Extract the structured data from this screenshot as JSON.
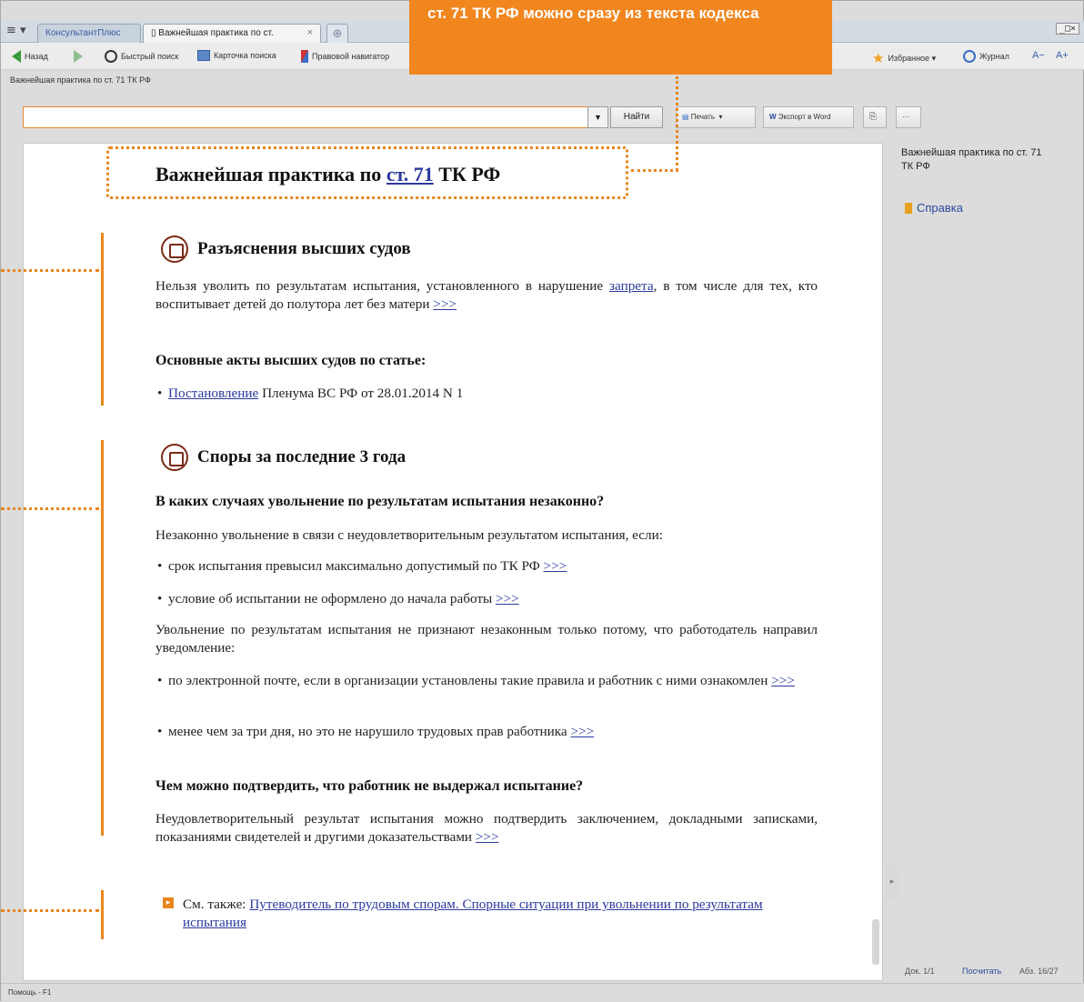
{
  "callout": {
    "text": "ст. 71 ТК РФ можно сразу из текста кодекса"
  },
  "window": {
    "controls": "_□×"
  },
  "tabs": [
    {
      "label": "КонсультантПлюс"
    },
    {
      "label": "Важнейшая практика по ст."
    }
  ],
  "toolbar": {
    "back": "Назад",
    "quick_search": "Быстрый поиск",
    "search_card": "Карточка поиска",
    "legal_navigator": "Правовой навигатор",
    "favorites": "Избранное ▾",
    "journal": "Журнал",
    "font_small": "A−",
    "font_large": "A+"
  },
  "breadcrumb": "Важнейшая практика по ст. 71 ТК РФ",
  "search": {
    "value": "",
    "find_label": "Найти",
    "dropdown": "▼"
  },
  "actions": {
    "print": "Печать",
    "print_arrow": "▾",
    "export_word": "Экспорт в Word",
    "more": "···"
  },
  "document": {
    "title_prefix": "Важнейшая практика по ",
    "title_link": "ст. 71",
    "title_suffix": " ТК РФ",
    "sec1": {
      "heading": "Разъяснения высших судов",
      "p1_a": "Нельзя уволить по результатам испытания, установленного в нарушение ",
      "p1_link": "запрета",
      "p1_b": ", в том числе для тех, кто воспитывает детей до полутора лет без матери ",
      "more": ">>>",
      "acts_heading": "Основные акты высших судов по статье:",
      "act_link": "Постановление",
      "act_rest": " Пленума ВС РФ от 28.01.2014 N 1"
    },
    "sec2": {
      "heading": "Споры за последние 3 года",
      "q1": "В каких случаях увольнение по результатам испытания незаконно?",
      "q1_intro": "Незаконно увольнение в связи с неудовлетворительным результатом испытания, если:",
      "b1": "срок испытания превысил максимально допустимый по ТК РФ ",
      "b2": "условие об испытании не оформлено до начала работы ",
      "p2": "Увольнение по результатам испытания не признают незаконным только потому, что работодатель направил уведомление:",
      "b3": "по электронной почте, если в организации установлены такие правила и работник с ними ознакомлен ",
      "b4": "менее чем за три дня, но это не нарушило трудовых прав работника ",
      "q2": "Чем можно подтвердить, что работник не выдержал испытание?",
      "p3": "Неудовлетворительный результат испытания можно подтвердить заключением, докладными записками, показаниями свидетелей и другими доказательствами ",
      "more": ">>>"
    },
    "see_also_label": "См. также: ",
    "see_also_link": "Путеводитель по трудовым спорам. Спорные ситуации при увольнении по результатам испытания"
  },
  "right_panel": {
    "title": "Важнейшая практика по ст. 71 ТК РФ",
    "help": "Справка",
    "doc_counter": "Док. 1/1",
    "count": "Посчитать",
    "paragraph": "Абз. 16/27"
  },
  "statusbar": "Помощь - F1",
  "colors": {
    "accent": "#e8861d",
    "link": "#2b3a9e"
  }
}
